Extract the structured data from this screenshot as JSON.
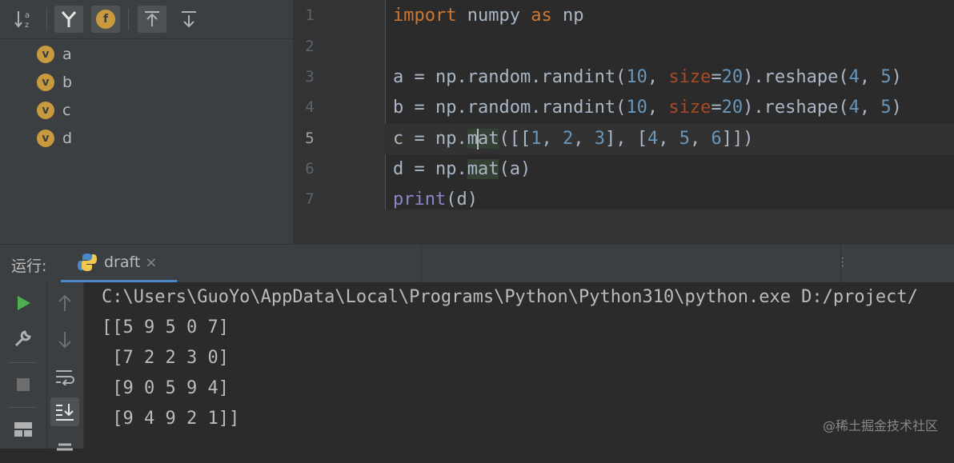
{
  "structure": {
    "items": [
      {
        "badge": "v",
        "label": "a"
      },
      {
        "badge": "v",
        "label": "b"
      },
      {
        "badge": "v",
        "label": "c"
      },
      {
        "badge": "v",
        "label": "d"
      }
    ],
    "toolbar": {
      "sort_icon": "sort-alpha-icon",
      "fields_badge": "f"
    }
  },
  "editor": {
    "line_numbers": [
      "1",
      "2",
      "3",
      "4",
      "5",
      "6",
      "7"
    ],
    "current_line": "5"
  },
  "run": {
    "label": "运行:",
    "tab_name": "draft",
    "tab_close": "×",
    "console_lines": [
      "C:\\Users\\GuoYo\\AppData\\Local\\Programs\\Python\\Python310\\python.exe D:/project/",
      "[[5 9 5 0 7]",
      " [7 2 2 3 0]",
      " [9 0 5 9 4]",
      " [9 4 9 2 1]]"
    ]
  },
  "watermark": "@稀土掘金技术社区"
}
